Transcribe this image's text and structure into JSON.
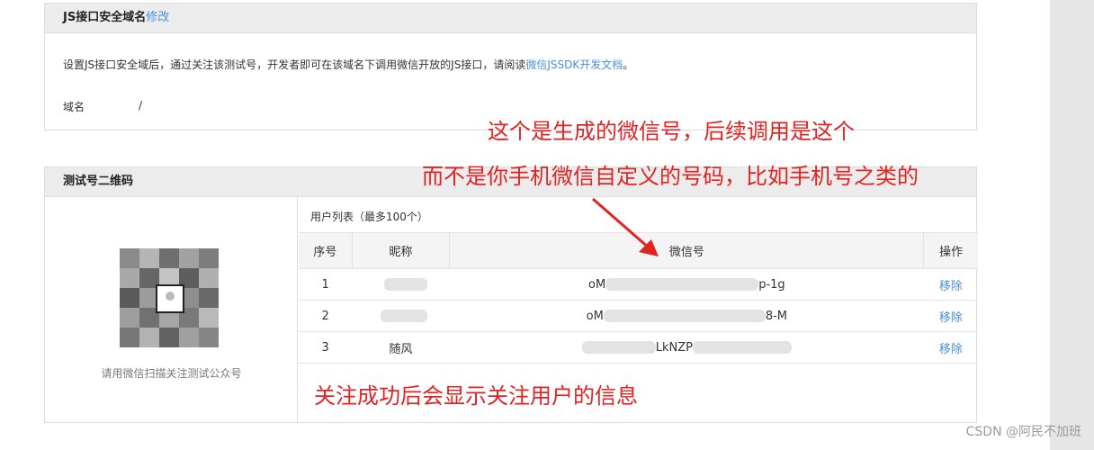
{
  "js_panel": {
    "title": "JS接口安全域名",
    "edit_label": "修改",
    "description": "设置JS接口安全域后，通过关注该测试号，开发者即可在该域名下调用微信开放的JS接口，请阅读",
    "doc_link": "微信JSSDK开发文档",
    "description_end": "。",
    "domain_label": "域名",
    "domain_value": "/"
  },
  "qr_panel": {
    "title": "测试号二维码",
    "qr_caption": "请用微信扫描关注测试公众号",
    "user_list_title": "用户列表（最多100个）",
    "columns": {
      "seq": "序号",
      "nick": "昵称",
      "wechat_id": "微信号",
      "action": "操作"
    },
    "rows": [
      {
        "seq": "1",
        "nick": "",
        "wechat_id_prefix": "oM",
        "wechat_id_suffix": "p-1g",
        "action": "移除"
      },
      {
        "seq": "2",
        "nick": "",
        "wechat_id_prefix": "oM",
        "wechat_id_suffix": "8-M",
        "action": "移除"
      },
      {
        "seq": "3",
        "nick": "随风",
        "wechat_id_prefix": "",
        "wechat_id_suffix": "LkNZP",
        "action": "移除"
      }
    ]
  },
  "annotations": {
    "line1": "这个是生成的微信号，后续调用是这个",
    "line2": "而不是你手机微信自定义的号码，比如手机号之类的",
    "line3": "关注成功后会显示关注用户的信息",
    "color": "#e32222"
  },
  "watermark": "CSDN @阿民不加班",
  "colors": {
    "link": "#4a90d9",
    "header_bg": "#ececec",
    "scroll_bg": "#e6e6e6"
  }
}
